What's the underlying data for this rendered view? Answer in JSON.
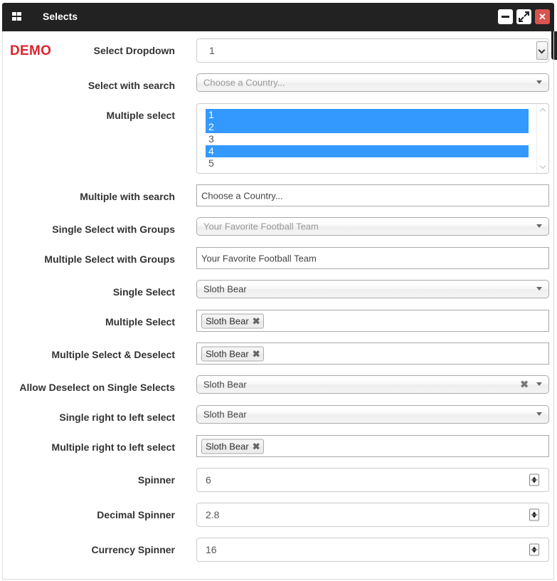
{
  "window": {
    "title": "Selects",
    "close_glyph": "✕",
    "maximize_glyph": "⤢"
  },
  "demo_label": "DEMO",
  "fields": {
    "select_dropdown": {
      "label": "Select Dropdown",
      "value": "1"
    },
    "select_with_search": {
      "label": "Select with search",
      "placeholder": "Choose a Country..."
    },
    "multiple_select_list": {
      "label": "Multiple select",
      "options": [
        {
          "text": "1",
          "selected": true
        },
        {
          "text": "2",
          "selected": true
        },
        {
          "text": "3",
          "selected": false
        },
        {
          "text": "4",
          "selected": true
        },
        {
          "text": "5",
          "selected": false
        }
      ]
    },
    "multiple_with_search": {
      "label": "Multiple with search",
      "placeholder": "Choose a Country..."
    },
    "single_select_groups": {
      "label": "Single Select with Groups",
      "placeholder": "Your Favorite Football Team"
    },
    "multiple_select_groups": {
      "label": "Multiple Select with Groups",
      "placeholder": "Your Favorite Football Team"
    },
    "single_select": {
      "label": "Single Select",
      "value": "Sloth Bear"
    },
    "multiple_select": {
      "label": "Multiple Select",
      "tag": "Sloth Bear"
    },
    "multiple_select_deselect": {
      "label": "Multiple Select & Deselect",
      "tag": "Sloth Bear"
    },
    "allow_deselect_single": {
      "label": "Allow Deselect on Single Selects",
      "value": "Sloth Bear"
    },
    "single_rtl": {
      "label": "Single right to left select",
      "value": "Sloth Bear"
    },
    "multiple_rtl": {
      "label": "Multiple right to left select",
      "tag": "Sloth Bear"
    },
    "spinner": {
      "label": "Spinner",
      "value": "6"
    },
    "decimal_spinner": {
      "label": "Decimal Spinner",
      "value": "2.8"
    },
    "currency_spinner": {
      "label": "Currency Spinner",
      "value": "16"
    }
  },
  "tag_remove_glyph": "✖"
}
